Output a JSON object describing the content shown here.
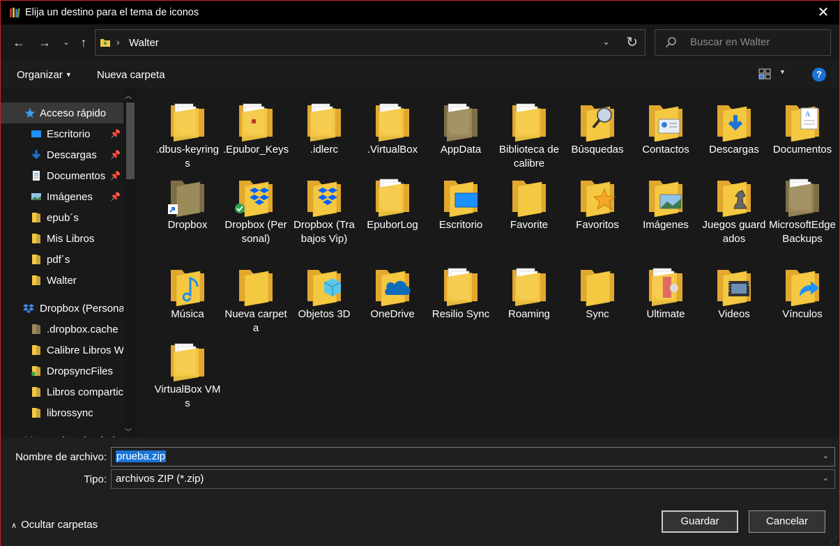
{
  "window": {
    "title": "Elija un destino para el tema de iconos"
  },
  "address": {
    "path": "Walter",
    "search_placeholder": "Buscar en Walter"
  },
  "toolbar": {
    "organize": "Organizar",
    "new_folder": "Nueva carpeta",
    "help": "?"
  },
  "sidebar": {
    "items": [
      {
        "label": "Acceso rápido",
        "icon": "star-icon"
      },
      {
        "label": "Escritorio",
        "icon": "desktop-icon"
      },
      {
        "label": "Descargas",
        "icon": "download-icon"
      },
      {
        "label": "Documentos",
        "icon": "document-icon"
      },
      {
        "label": "Imágenes",
        "icon": "picture-icon"
      },
      {
        "label": "epub´s",
        "icon": "folder-icon"
      },
      {
        "label": "Mis Libros",
        "icon": "folder-icon"
      },
      {
        "label": "pdf´s",
        "icon": "folder-icon"
      },
      {
        "label": "Walter",
        "icon": "folder-icon"
      },
      {
        "label": "Dropbox (Persona",
        "icon": "dropbox-icon"
      },
      {
        "label": ".dropbox.cache",
        "icon": "folder-icon"
      },
      {
        "label": "Calibre Libros W",
        "icon": "folder-icon"
      },
      {
        "label": "DropsyncFiles",
        "icon": "folder-icon"
      },
      {
        "label": "Libros compartic",
        "icon": "folder-icon"
      },
      {
        "label": "librossync",
        "icon": "folder-icon"
      },
      {
        "label": "Dropbox (Trabajo",
        "icon": "dropbox-icon"
      }
    ]
  },
  "items": [
    {
      "label": ".dbus-keyrings",
      "type": "doc"
    },
    {
      "label": ".Epubor_Keys",
      "type": "doc-yellow"
    },
    {
      "label": ".idlerc",
      "type": "doc"
    },
    {
      "label": ".VirtualBox",
      "type": "doc"
    },
    {
      "label": "AppData",
      "type": "dark"
    },
    {
      "label": "Biblioteca de calibre",
      "type": "doc"
    },
    {
      "label": "Búsquedas",
      "type": "search"
    },
    {
      "label": "Contactos",
      "type": "contacts"
    },
    {
      "label": "Descargas",
      "type": "download"
    },
    {
      "label": "Documentos",
      "type": "documents"
    },
    {
      "label": "Dropbox",
      "type": "dark-shortcut"
    },
    {
      "label": "Dropbox (Personal)",
      "type": "dropbox-check"
    },
    {
      "label": "Dropbox (Trabajos Vip)",
      "type": "dropbox"
    },
    {
      "label": "EpuborLog",
      "type": "doc"
    },
    {
      "label": "Escritorio",
      "type": "desktop"
    },
    {
      "label": "Favorite",
      "type": "plain"
    },
    {
      "label": "Favoritos",
      "type": "star"
    },
    {
      "label": "Imágenes",
      "type": "pictures"
    },
    {
      "label": "Juegos guardados",
      "type": "chess"
    },
    {
      "label": "MicrosoftEdgeBackups",
      "type": "dark"
    },
    {
      "label": "Música",
      "type": "music"
    },
    {
      "label": "Nueva carpeta",
      "type": "plain"
    },
    {
      "label": "Objetos 3D",
      "type": "cube"
    },
    {
      "label": "OneDrive",
      "type": "cloud"
    },
    {
      "label": "Resilio Sync",
      "type": "doc"
    },
    {
      "label": "Roaming",
      "type": "doc"
    },
    {
      "label": "Sync",
      "type": "plain"
    },
    {
      "label": "Ultimate",
      "type": "ultimate"
    },
    {
      "label": "Videos",
      "type": "video"
    },
    {
      "label": "Vínculos",
      "type": "link"
    },
    {
      "label": "VirtualBox VMs",
      "type": "doc"
    }
  ],
  "form": {
    "filename_label": "Nombre de archivo:",
    "filename_value": "prueba.zip",
    "type_label": "Tipo:",
    "type_value": "archivos ZIP (*.zip)"
  },
  "footer": {
    "hide_folders": "Ocultar carpetas",
    "save": "Guardar",
    "cancel": "Cancelar"
  },
  "colors": {
    "folder": "#f5c842",
    "folder_dark": "#9b8a5a",
    "accent": "#1a74d8",
    "border_red": "#c4262e"
  }
}
